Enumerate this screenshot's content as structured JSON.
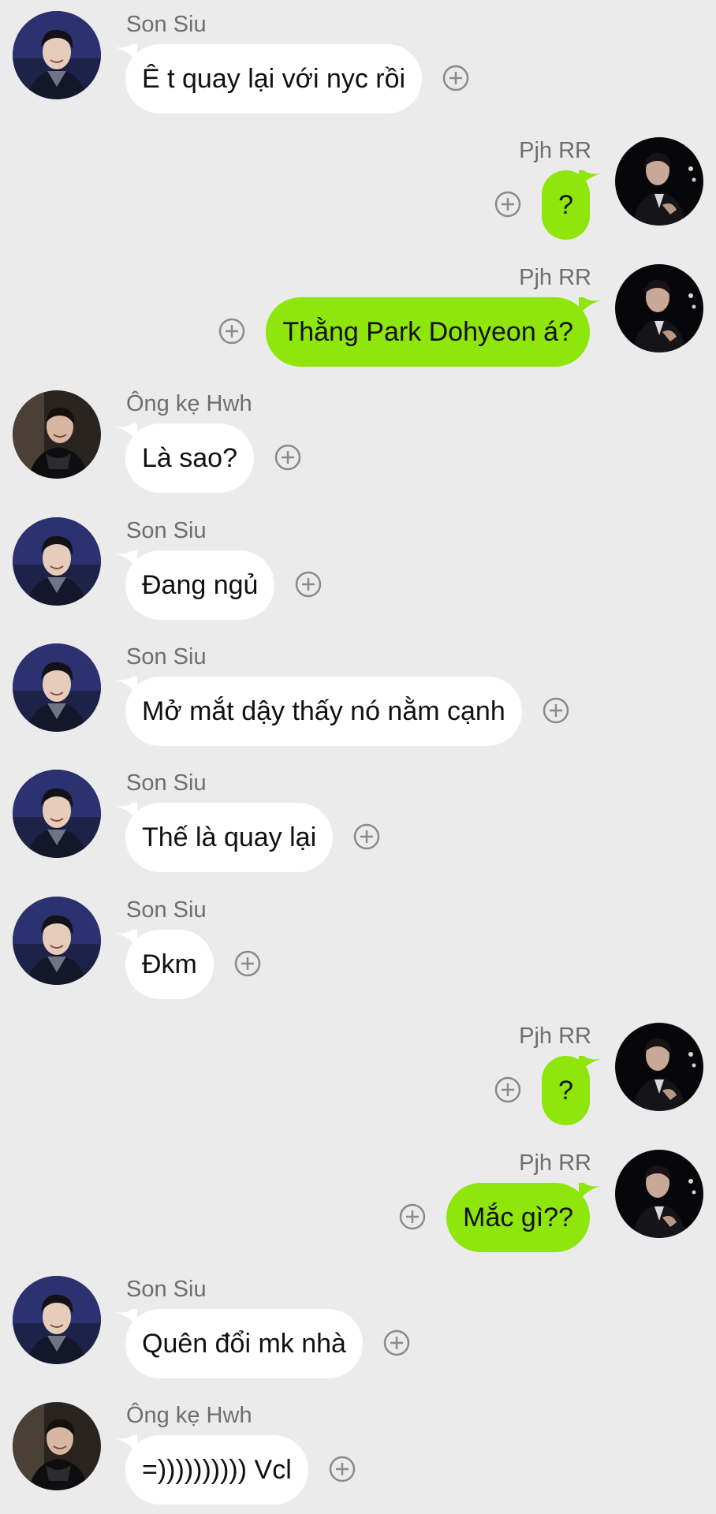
{
  "messages": [
    {
      "side": "left",
      "avatar": "son",
      "sender": "Son Siu",
      "text": "Ê t quay lại với nyc rồi"
    },
    {
      "side": "right",
      "avatar": "pjh",
      "sender": "Pjh RR",
      "text": "?"
    },
    {
      "side": "right",
      "avatar": "pjh",
      "sender": "Pjh RR",
      "text": "Thằng Park Dohyeon á?"
    },
    {
      "side": "left",
      "avatar": "hwh",
      "sender": "Ông kẹ Hwh",
      "text": "Là sao?"
    },
    {
      "side": "left",
      "avatar": "son",
      "sender": "Son Siu",
      "text": "Đang ngủ"
    },
    {
      "side": "left",
      "avatar": "son",
      "sender": "Son Siu",
      "text": "Mở mắt dậy thấy nó nằm cạnh"
    },
    {
      "side": "left",
      "avatar": "son",
      "sender": "Son Siu",
      "text": "Thế là quay lại"
    },
    {
      "side": "left",
      "avatar": "son",
      "sender": "Son Siu",
      "text": "Đkm"
    },
    {
      "side": "right",
      "avatar": "pjh",
      "sender": "Pjh RR",
      "text": "?"
    },
    {
      "side": "right",
      "avatar": "pjh",
      "sender": "Pjh RR",
      "text": "Mắc gì??"
    },
    {
      "side": "left",
      "avatar": "son",
      "sender": "Son Siu",
      "text": "Quên đổi mk nhà"
    },
    {
      "side": "left",
      "avatar": "hwh",
      "sender": "Ông kẹ Hwh",
      "text": "=)))))))))) Vcl"
    }
  ],
  "icons": {
    "react": "add-reaction-icon"
  },
  "colors": {
    "background": "#ebebeb",
    "outgoing_bubble": "#8ee60c",
    "incoming_bubble": "#ffffff",
    "sender_name": "#6e6e6e",
    "text": "#111111"
  }
}
